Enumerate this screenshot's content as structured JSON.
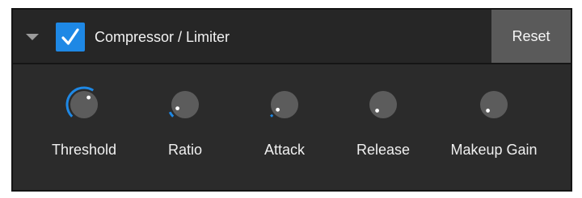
{
  "panel": {
    "enabled": true,
    "title": "Compressor / Limiter",
    "reset_label": "Reset"
  },
  "knobs": [
    {
      "label": "Threshold",
      "level": 0.62
    },
    {
      "label": "Ratio",
      "level": 0.07
    },
    {
      "label": "Attack",
      "level": 0.03
    },
    {
      "label": "Release",
      "level": 0.0
    },
    {
      "label": "Makeup Gain",
      "level": 0.0
    }
  ],
  "colors": {
    "accent": "#1e88e5",
    "knob_body": "#5c5c5c",
    "knob_dot": "#ffffff",
    "panel_bg": "#2b2b2b"
  },
  "icons": {
    "collapse": "triangle-down-icon",
    "check": "check-icon"
  }
}
